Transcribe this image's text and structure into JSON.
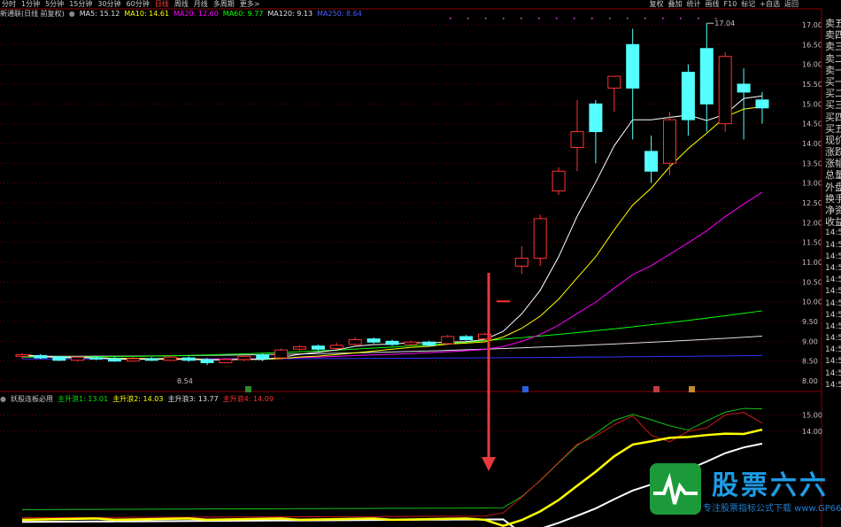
{
  "toolbar": {
    "periods": [
      "分时",
      "1分钟",
      "5分钟",
      "15分钟",
      "30分钟",
      "60分钟",
      "日线",
      "周线",
      "月线",
      "多周期",
      "更多>"
    ],
    "active_period": "日线",
    "right_buttons": [
      "复权",
      "叠加",
      "统计",
      "画线",
      "F10",
      "标记",
      "+自选",
      "返回"
    ]
  },
  "main_legend": {
    "title": "新通联(日线 前复权)",
    "ma5": "MA5: 15.12",
    "ma10": "MA10: 14.61",
    "ma20": "MA20: 12.60",
    "ma60": "MA60: 9.77",
    "ma120": "MA120: 9.13",
    "ma250": "MA250: 8.64"
  },
  "sub_legend": {
    "title": "妖股连板必用",
    "l1": "主升浪1: 13.01",
    "l2": "主升浪2: 14.03",
    "l3": "主升浪3: 13.77",
    "l4": "主升浪4: 14.09"
  },
  "annotations": {
    "high": "17.04",
    "low": "8.54"
  },
  "price_axis": [
    "17.00",
    "16.50",
    "16.00",
    "15.50",
    "15.00",
    "14.50",
    "14.00",
    "13.50",
    "13.00",
    "12.50",
    "12.00",
    "11.50",
    "11.00",
    "10.50",
    "10.00",
    "9.50",
    "9.00",
    "8.50",
    "8.00"
  ],
  "sub_axis": [
    "15.00",
    "14.00"
  ],
  "sidebar": [
    "卖五",
    "卖四",
    "卖三",
    "卖二",
    "卖一",
    "买一",
    "买二",
    "买三",
    "买四",
    "买五",
    "现价",
    "涨跌",
    "涨幅",
    "总量",
    "外盘",
    "换手",
    "净资",
    "收益"
  ],
  "sidebar_times": [
    "14:5",
    "14:5",
    "14:5",
    "14:5",
    "14:5",
    "14:5",
    "14:5",
    "14:5",
    "14:5",
    "14:5",
    "14:5",
    "14:5",
    "14:5",
    "14:5",
    "14:5",
    "14:5",
    "14:5",
    "14:5",
    "14:5",
    "14:5",
    "14:5",
    "14:5",
    "14:5",
    "14:5",
    "14:5",
    "14:5",
    "14:5",
    "14:5",
    "14:5",
    "14:5",
    "14:5"
  ],
  "watermark": {
    "brand": "股票六六",
    "sub": "专注股票指标公式下载 www.GP66.CN"
  },
  "candles": [
    [
      8.62,
      8.66,
      8.55,
      8.7
    ],
    [
      8.64,
      8.58,
      8.55,
      8.68
    ],
    [
      8.6,
      8.52,
      8.5,
      8.63
    ],
    [
      8.52,
      8.6,
      8.49,
      8.64
    ],
    [
      8.58,
      8.55,
      8.52,
      8.62
    ],
    [
      8.56,
      8.5,
      8.48,
      8.6
    ],
    [
      8.5,
      8.56,
      8.48,
      8.62
    ],
    [
      8.56,
      8.52,
      8.5,
      8.6
    ],
    [
      8.52,
      8.6,
      8.5,
      8.64
    ],
    [
      8.58,
      8.52,
      8.48,
      8.62
    ],
    [
      8.54,
      8.46,
      8.4,
      8.58
    ],
    [
      8.46,
      8.54,
      8.44,
      8.58
    ],
    [
      8.54,
      8.62,
      8.5,
      8.66
    ],
    [
      8.66,
      8.56,
      8.5,
      8.7
    ],
    [
      8.58,
      8.78,
      8.54,
      8.82
    ],
    [
      8.8,
      8.86,
      8.76,
      8.9
    ],
    [
      8.88,
      8.8,
      8.76,
      8.92
    ],
    [
      8.82,
      8.9,
      8.8,
      8.96
    ],
    [
      8.92,
      9.04,
      8.9,
      9.1
    ],
    [
      9.06,
      8.98,
      8.94,
      9.1
    ],
    [
      9.0,
      8.92,
      8.88,
      9.04
    ],
    [
      8.92,
      8.98,
      8.88,
      9.02
    ],
    [
      8.98,
      8.9,
      8.86,
      9.02
    ],
    [
      8.94,
      9.12,
      8.9,
      9.16
    ],
    [
      9.12,
      9.04,
      9.0,
      9.16
    ],
    [
      9.06,
      9.18,
      9.02,
      9.22
    ],
    [
      10.02,
      10.02,
      10.02,
      10.02
    ],
    [
      10.9,
      11.1,
      10.7,
      11.4
    ],
    [
      11.1,
      12.1,
      10.9,
      12.2
    ],
    [
      12.8,
      13.3,
      12.7,
      13.4
    ],
    [
      13.9,
      14.3,
      13.3,
      15.1
    ],
    [
      15.0,
      14.3,
      13.5,
      15.1
    ],
    [
      15.4,
      15.7,
      14.8,
      15.7
    ],
    [
      16.5,
      15.4,
      14.1,
      16.9
    ],
    [
      13.8,
      13.3,
      13.0,
      14.2
    ],
    [
      13.5,
      14.6,
      13.2,
      14.8
    ],
    [
      15.8,
      14.6,
      14.2,
      16.0
    ],
    [
      16.4,
      15.0,
      14.3,
      17.04
    ],
    [
      14.5,
      16.2,
      14.3,
      16.3
    ],
    [
      15.5,
      15.3,
      14.1,
      15.9
    ],
    [
      15.1,
      14.9,
      14.5,
      15.3
    ]
  ],
  "colors": {
    "up": "#ff3232",
    "down": "#54ffff",
    "ma5": "#ffffff",
    "ma10": "#ffff00",
    "ma20": "#ff00ff",
    "ma60": "#00ff00",
    "ma120": "#e0e0e0",
    "ma250": "#3232ff"
  }
}
